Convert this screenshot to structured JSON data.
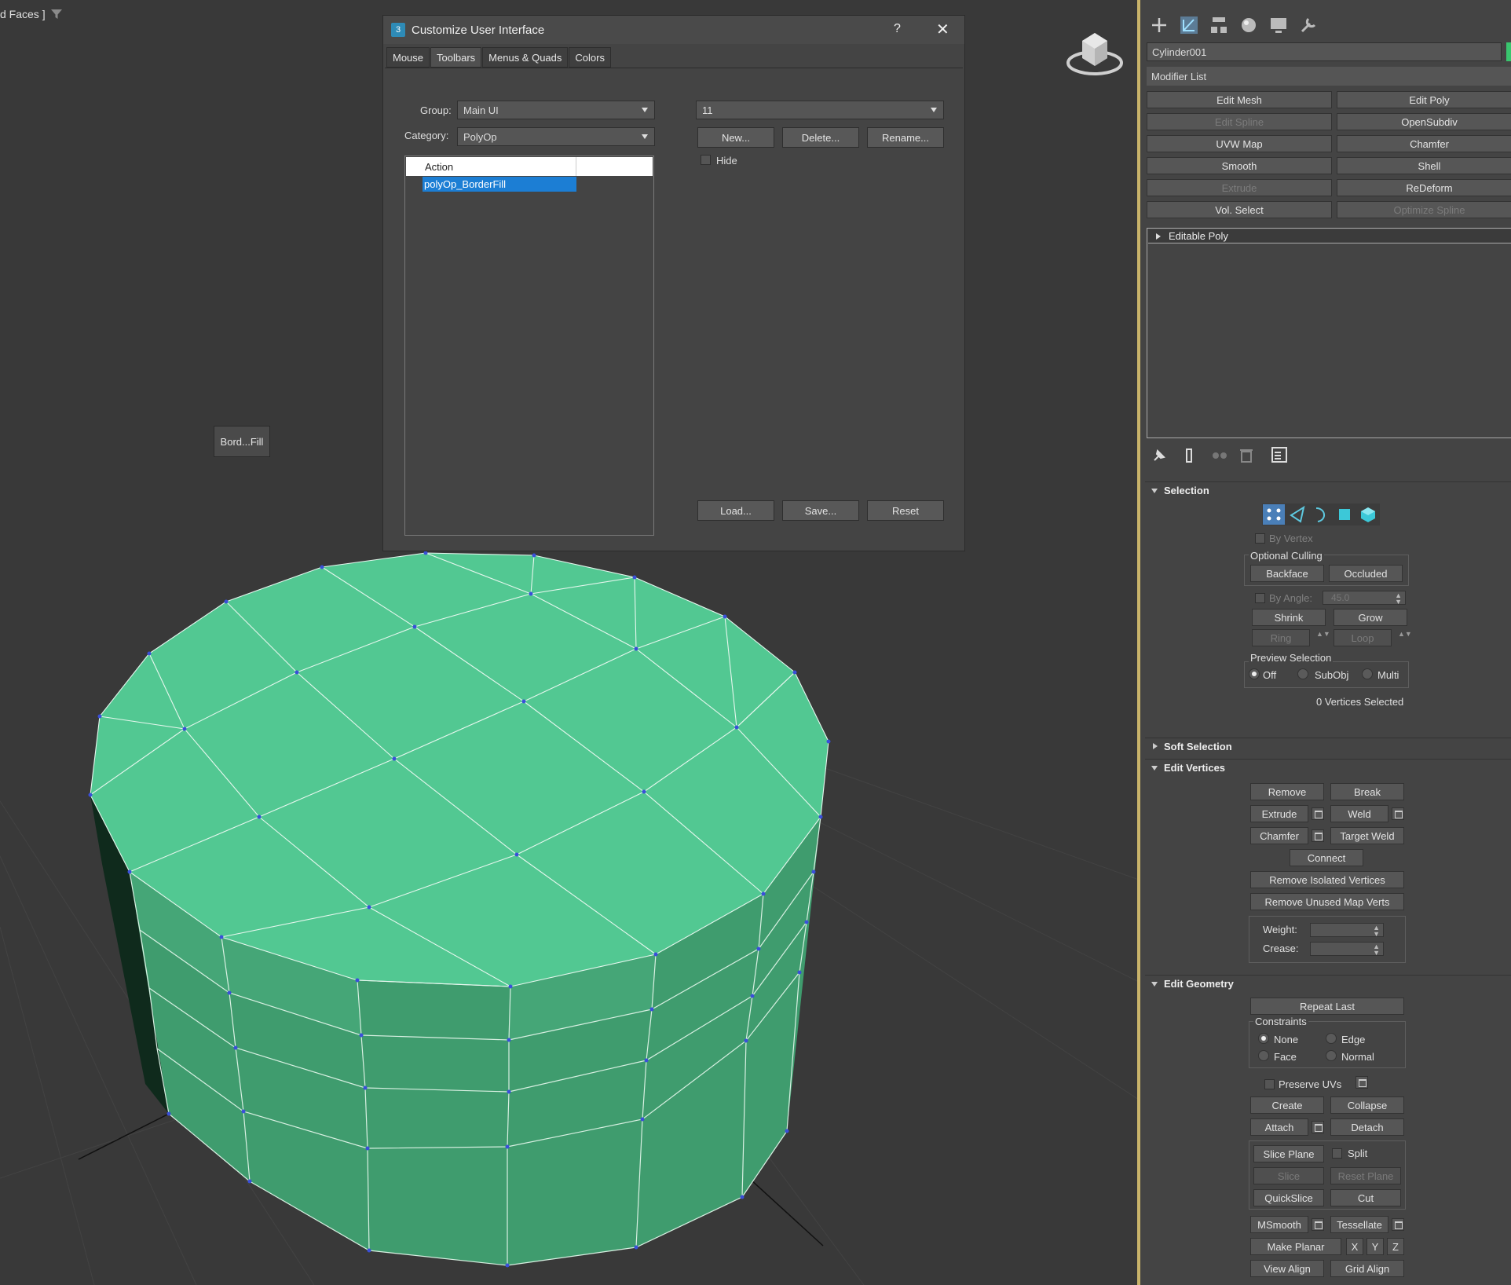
{
  "viewport": {
    "label": "d Faces ]",
    "float_button": "Bord...Fill"
  },
  "dialog": {
    "title": "Customize User Interface",
    "help": "?",
    "close": "✕",
    "tabs": [
      "Mouse",
      "Toolbars",
      "Menus & Quads",
      "Colors"
    ],
    "group_label": "Group:",
    "group_value": "Main UI",
    "category_label": "Category:",
    "category_value": "PolyOp",
    "list_header": "Action",
    "list_selected": "polyOp_BorderFill",
    "toolbar_value": "11",
    "new_btn": "New...",
    "delete_btn": "Delete...",
    "rename_btn": "Rename...",
    "hide_label": "Hide",
    "load_btn": "Load...",
    "save_btn": "Save...",
    "reset_btn": "Reset"
  },
  "panel": {
    "object_name": "Cylinder001",
    "object_color": "#39c56e",
    "modifier_list": "Modifier List",
    "modifier_buttons": [
      {
        "label": "Edit Mesh",
        "enabled": true
      },
      {
        "label": "Edit Poly",
        "enabled": true
      },
      {
        "label": "Edit Spline",
        "enabled": false
      },
      {
        "label": "OpenSubdiv",
        "enabled": true
      },
      {
        "label": "UVW Map",
        "enabled": true
      },
      {
        "label": "Chamfer",
        "enabled": true
      },
      {
        "label": "Smooth",
        "enabled": true
      },
      {
        "label": "Shell",
        "enabled": true
      },
      {
        "label": "Extrude",
        "enabled": false
      },
      {
        "label": "ReDeform",
        "enabled": true
      },
      {
        "label": "Vol. Select",
        "enabled": true
      },
      {
        "label": "Optimize Spline",
        "enabled": false
      }
    ],
    "stack_item": "Editable Poly",
    "selection": {
      "title": "Selection",
      "by_vertex": "By Vertex",
      "optional_culling": "Optional Culling",
      "backface": "Backface",
      "occluded": "Occluded",
      "by_angle": "By Angle:",
      "angle_value": "45.0",
      "shrink": "Shrink",
      "grow": "Grow",
      "ring": "Ring",
      "loop": "Loop",
      "preview_selection": "Preview Selection",
      "off": "Off",
      "subobj": "SubObj",
      "multi": "Multi",
      "status": "0 Vertices Selected"
    },
    "soft_selection": "Soft Selection",
    "edit_vertices": {
      "title": "Edit Vertices",
      "remove": "Remove",
      "break": "Break",
      "extrude": "Extrude",
      "weld": "Weld",
      "chamfer": "Chamfer",
      "target_weld": "Target Weld",
      "connect": "Connect",
      "remove_isolated": "Remove Isolated Vertices",
      "remove_unused": "Remove Unused Map Verts",
      "weight": "Weight:",
      "crease": "Crease:"
    },
    "edit_geometry": {
      "title": "Edit Geometry",
      "repeat_last": "Repeat Last",
      "constraints": "Constraints",
      "none": "None",
      "edge": "Edge",
      "face": "Face",
      "normal": "Normal",
      "preserve_uvs": "Preserve UVs",
      "create": "Create",
      "collapse": "Collapse",
      "attach": "Attach",
      "detach": "Detach",
      "slice_plane": "Slice Plane",
      "split": "Split",
      "slice": "Slice",
      "reset_plane": "Reset Plane",
      "quickslice": "QuickSlice",
      "cut": "Cut",
      "msmooth": "MSmooth",
      "tessellate": "Tessellate",
      "make_planar": "Make Planar",
      "x": "X",
      "y": "Y",
      "z": "Z",
      "view_align": "View Align",
      "grid_align": "Grid Align"
    }
  }
}
